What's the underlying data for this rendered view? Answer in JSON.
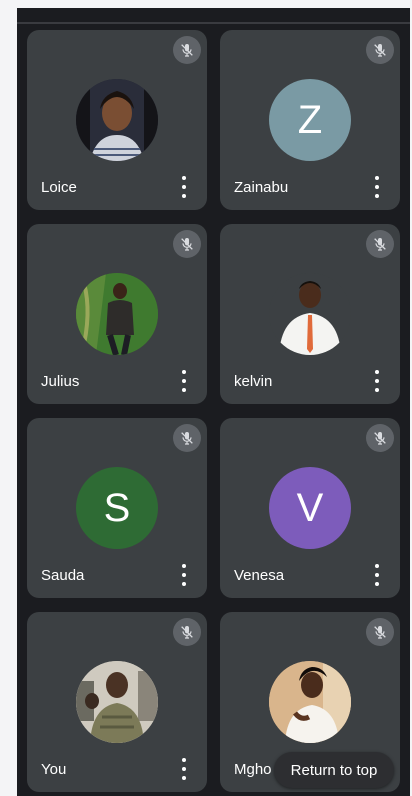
{
  "participants": [
    {
      "name": "Loice",
      "initial": "",
      "avatar_type": "photo",
      "mic": "muted"
    },
    {
      "name": "Zainabu",
      "initial": "Z",
      "avatar_type": "initial",
      "avatar_color": "#7a9aa4",
      "mic": "muted"
    },
    {
      "name": "Julius",
      "initial": "",
      "avatar_type": "photo",
      "mic": "muted"
    },
    {
      "name": "kelvin",
      "initial": "",
      "avatar_type": "photo",
      "mic": "muted"
    },
    {
      "name": "Sauda",
      "initial": "S",
      "avatar_type": "initial",
      "avatar_color": "#2e6b34",
      "mic": "muted"
    },
    {
      "name": "Venesa",
      "initial": "V",
      "avatar_type": "initial",
      "avatar_color": "#7d5cbb",
      "mic": "muted"
    },
    {
      "name": "You",
      "initial": "",
      "avatar_type": "photo",
      "mic": "muted"
    },
    {
      "name": "Mgho",
      "initial": "",
      "avatar_type": "photo",
      "mic": "muted"
    }
  ],
  "return_to_top_label": "Return to top",
  "colors": {
    "background": "#1b1c20",
    "tile": "#3c4043",
    "mic_badge": "#5f6368"
  },
  "icons": {
    "mic": "mic-off-icon",
    "menu": "more-vert-icon"
  }
}
